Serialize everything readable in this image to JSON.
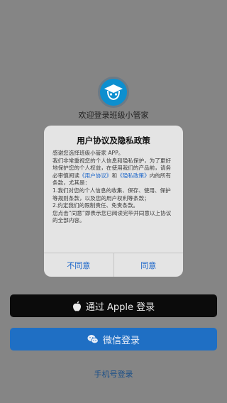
{
  "colors": {
    "overlay_background": "#858585",
    "dialog_background": "#e4e4e4",
    "link_blue": "#1763c9",
    "apple_button": "#0b0b0b",
    "wechat_button": "#1f6fc4",
    "logo_blue": "#0d8fcf"
  },
  "logo": {
    "icon": "graduation-cap-face-icon"
  },
  "welcome_text": "欢迎登录班级小管家",
  "dialog": {
    "title": "用户协议及隐私政策",
    "line1": "感谢您选择班级小管家 APP。",
    "line2_pre": "我们非常重视您的个人信息和隐私保护，为了更好地保护您的个人权益，在使用我们的产品前，请务必审慎阅读",
    "link_user_agreement": "《用户协议》",
    "and_text": "和",
    "link_privacy_policy": "《隐私政策》",
    "line2_post": "内的所有条款，尤其是：",
    "item1": "1.我们对您的个人信息的收集、保存、使用、保护等规则条款，以及您的用户权利等条款；",
    "item2": "2.约定我们的限制责任、免责条款。",
    "footer_text": "您点击“同意”即表示您已阅读完毕并同意以上协议的全部内容。",
    "disagree_label": "不同意",
    "agree_label": "同意"
  },
  "apple_login": {
    "icon": "apple-icon",
    "label": "通过 Apple 登录"
  },
  "wechat_login": {
    "icon": "wechat-icon",
    "label": "微信登录"
  },
  "phone_login_label": "手机号登录"
}
